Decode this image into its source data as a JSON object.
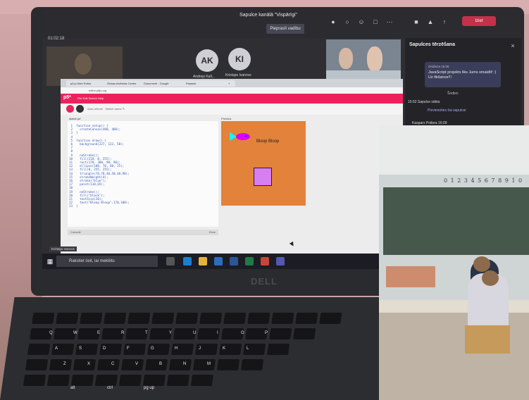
{
  "teams": {
    "title": "Sapulce kanālā \"Vispārīgi\"",
    "timer": "01:02:18",
    "join_button": "Pieprasīt vadību",
    "leave_button": "Iziet",
    "participants": [
      {
        "initials": "AK",
        "name": "Andrejs Kall..."
      },
      {
        "initials": "KI",
        "name": "Kristaps Ivanovs"
      }
    ],
    "chat": {
      "title": "Sapulces tērzēšana",
      "message_meta": "Oridiena 15:06",
      "message_text": "JavaScript projekts liks Jums smaidīt! :) Uz tikšanos!!!",
      "today_label": "Šodien",
      "meeting_started": "15:52   Sapulce sākta",
      "join_link": "Pievienoties šai sapulcei",
      "person": "Kaspars Poltera   16:09"
    }
  },
  "browser": {
    "tabs": [
      "p5.js Web Editor",
      "Zinbas Atvērtais Centrs",
      "Dokumenti - Google",
      "Pasaule",
      "+"
    ],
    "url": "editor.p5js.org"
  },
  "p5": {
    "logo": "p5*",
    "menu": "File   Edit   Sketch   Help",
    "auto_refresh": "Auto-refresh",
    "sketch_name": "Sketch name ✎",
    "file_tab": "sketch.js*",
    "code_lines": [
      " 1  function setup() {",
      " 2    createCanvas(400, 400);",
      " 3  }",
      " 4",
      " 5  function draw() {",
      " 6    background(227, 122, 58);",
      " 7",
      " 8",
      " 9    noStroke();",
      "10    fill(218, 0, 255);",
      "11    rect(170, 300, 90, 90);",
      "12    ellipse(100, 70, 60, 25);",
      "13    fill(0, 255, 255);",
      "14    triangle(70,70,40,50,40,90);",
      "15    strokeWeight(4);",
      "16    stroke(\"blue\");",
      "17    point(110,65);",
      "18",
      "19    noStroke();",
      "20    fill(\"black\");",
      "21    textSize(20);",
      "22    text(\"Bloop Bloop\",170,100);",
      "23  }"
    ],
    "console_label": "Console",
    "clear_label": "Clear",
    "preview_label": "Preview",
    "canvas_text": "Bloop Bloop"
  },
  "taskbar": {
    "search_placeholder": "Rakstiet šeit, lai meklētu",
    "user_chip": "Kristaps Ivanovs"
  },
  "laptop": {
    "brand": "DELL"
  },
  "keyboard": {
    "labels": [
      "Q",
      "W",
      "E",
      "R",
      "T",
      "Y",
      "U",
      "I",
      "O",
      "P",
      "A",
      "S",
      "D",
      "F",
      "G",
      "H",
      "J",
      "K",
      "L",
      "Z",
      "X",
      "C",
      "V",
      "B",
      "N",
      "M",
      "alt",
      "ctrl",
      "pg up"
    ]
  },
  "classroom": {
    "digits": "0 1 2 3 4 5 6 7 8 9 1 0"
  },
  "colors": {
    "p5_pink": "#ed225d",
    "canvas_orange": "#e3823a",
    "square_purple": "#d77ef0",
    "teams_red": "#c4314b"
  }
}
